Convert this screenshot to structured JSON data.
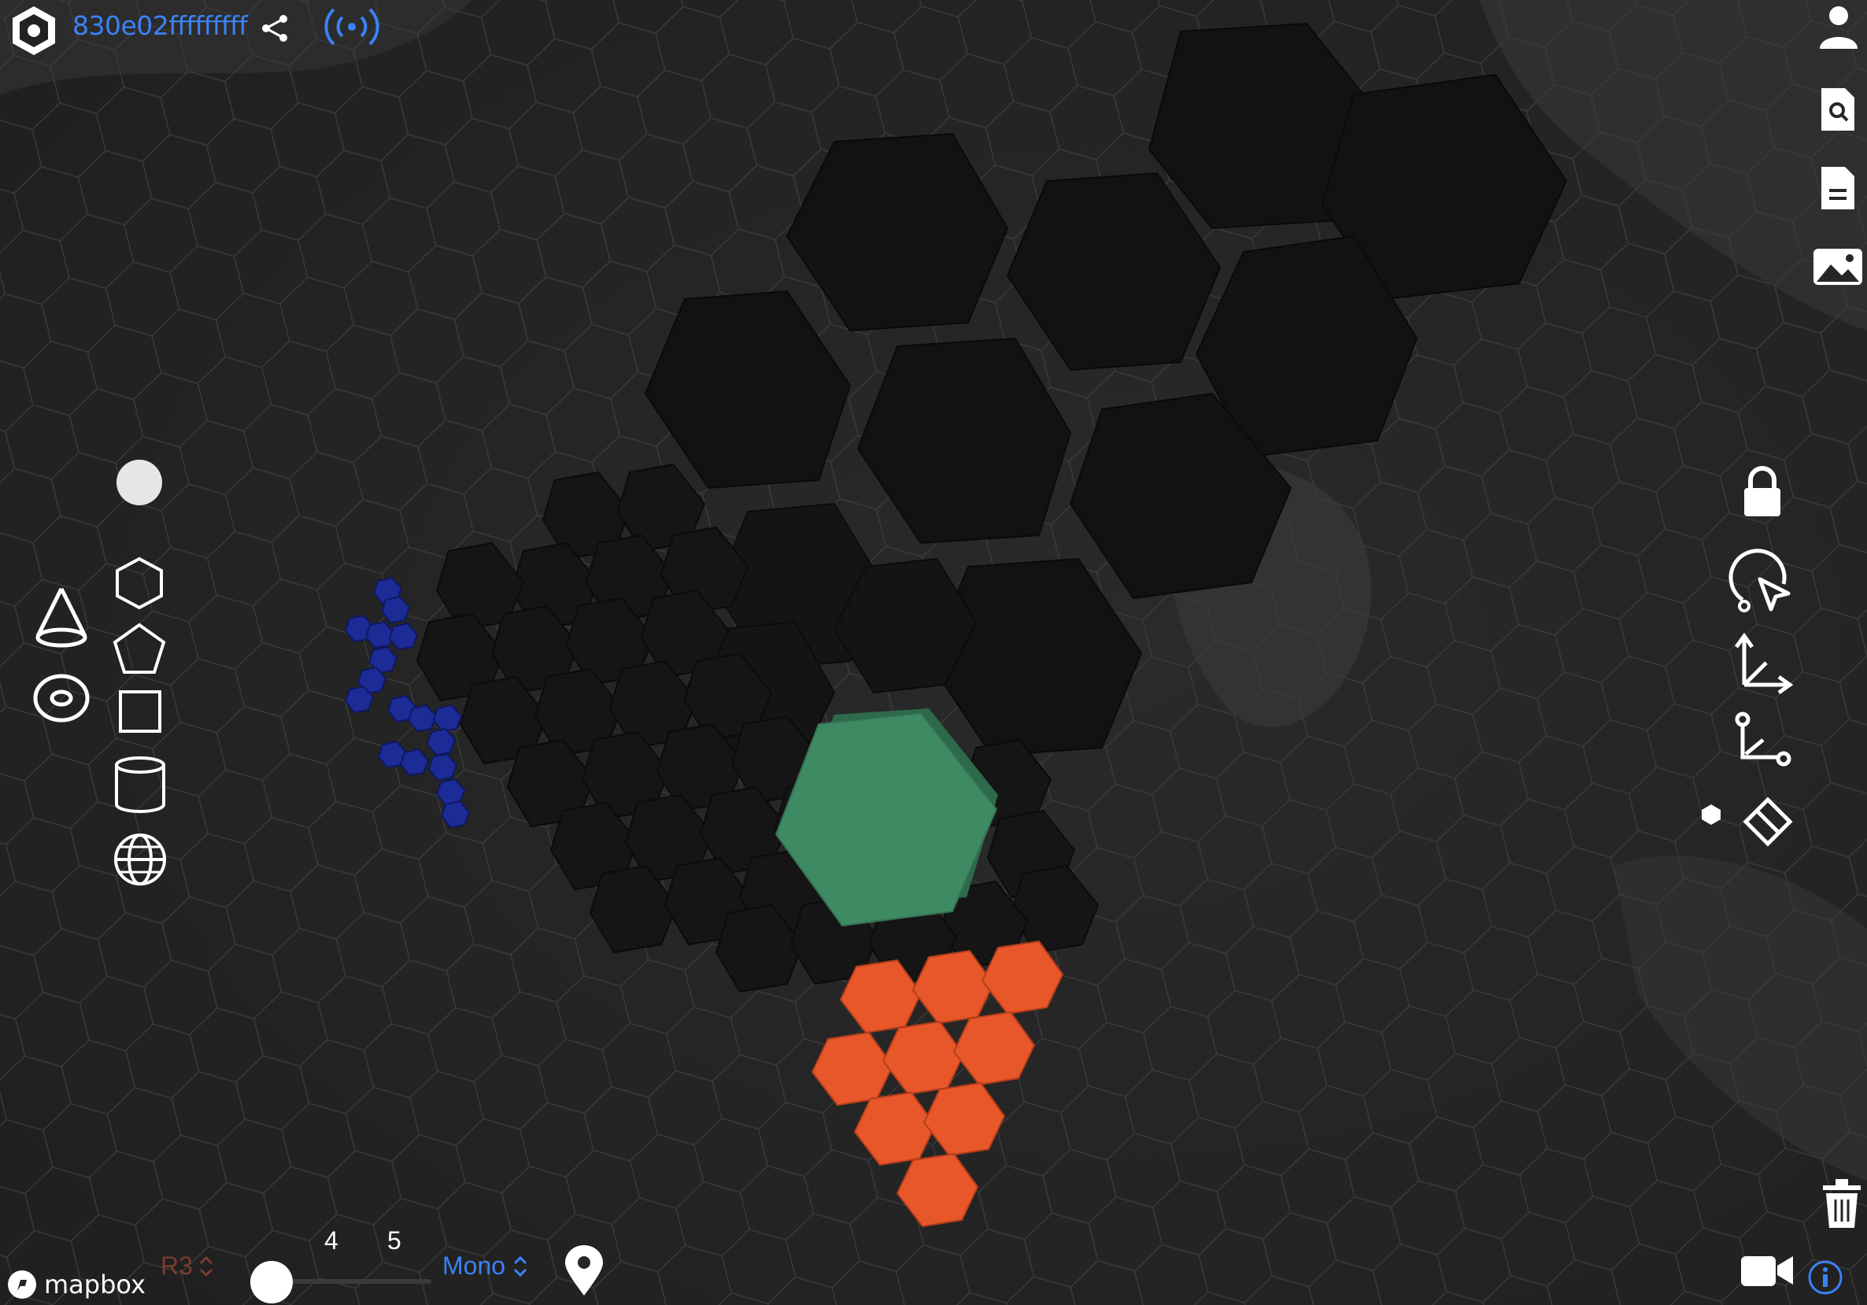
{
  "header": {
    "cell_id": "830e02fffffffff",
    "logo_icon": "hexagon-logo-icon",
    "share_icon": "share-icon",
    "live_icon": "broadcast-icon"
  },
  "right_toolbar": {
    "icons": [
      "user-icon",
      "search-document-icon",
      "list-document-icon",
      "image-icon",
      "lock-icon",
      "orbit-cursor-icon",
      "axes-icon",
      "path-icon",
      "hexagon-small-icon",
      "eraser-icon",
      "trash-icon",
      "camera-icon",
      "info-icon"
    ]
  },
  "left_toolbar": {
    "tools": [
      "circle",
      "cone",
      "ring",
      "hexagon",
      "pentagon",
      "square",
      "cylinder",
      "sphere"
    ]
  },
  "footer": {
    "mapbox_label": "mapbox",
    "resolution_label": "R3",
    "slider_ticks": [
      "4",
      "5"
    ],
    "style_label": "Mono"
  },
  "colors": {
    "accent": "#3b82f6",
    "background": "#262626",
    "grid": "#3a3a3a",
    "black_cells": "#111111",
    "green_cell": "#3e8a63",
    "orange_cells": "#e8572a",
    "blue_cells": "#1b2a8c"
  }
}
